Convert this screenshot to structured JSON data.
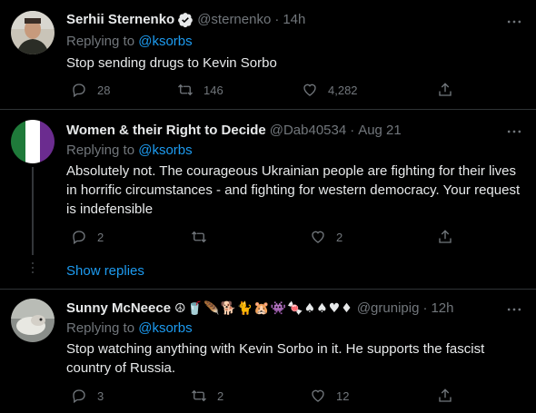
{
  "tweets": [
    {
      "name": "Serhii Sternenko",
      "handle": "@sternenko",
      "time": "14h",
      "replying_prefix": "Replying to",
      "replying_to": "@ksorbs",
      "text": "Stop sending drugs to Kevin Sorbo",
      "replies": "28",
      "retweets": "146",
      "likes": "4,282"
    },
    {
      "name": "Women & their Right to Decide",
      "handle": "@Dab40534",
      "time": "Aug 21",
      "replying_prefix": "Replying to",
      "replying_to": "@ksorbs",
      "text": "Absolutely not. The courageous Ukrainian people are fighting for their lives in horrific circumstances - and fighting for western democracy. Your request is indefensible",
      "replies": "2",
      "retweets": "",
      "likes": "2"
    },
    {
      "name": "Sunny McNeece",
      "name_emojis": "☮🥤🪶🐕🐈🐹👾🍬♠♠♥♦",
      "handle": "@grunipig",
      "time": "12h",
      "replying_prefix": "Replying to",
      "replying_to": "@ksorbs",
      "text": "Stop watching anything with Kevin Sorbo in it.  He supports the fascist country of Russia.",
      "replies": "3",
      "retweets": "2",
      "likes": "12"
    }
  ],
  "show_replies": "Show replies",
  "separator": "·",
  "colors": {
    "accent": "#1d9bf0",
    "muted": "#71767b",
    "text": "#e7e9ea",
    "background": "#000000"
  }
}
